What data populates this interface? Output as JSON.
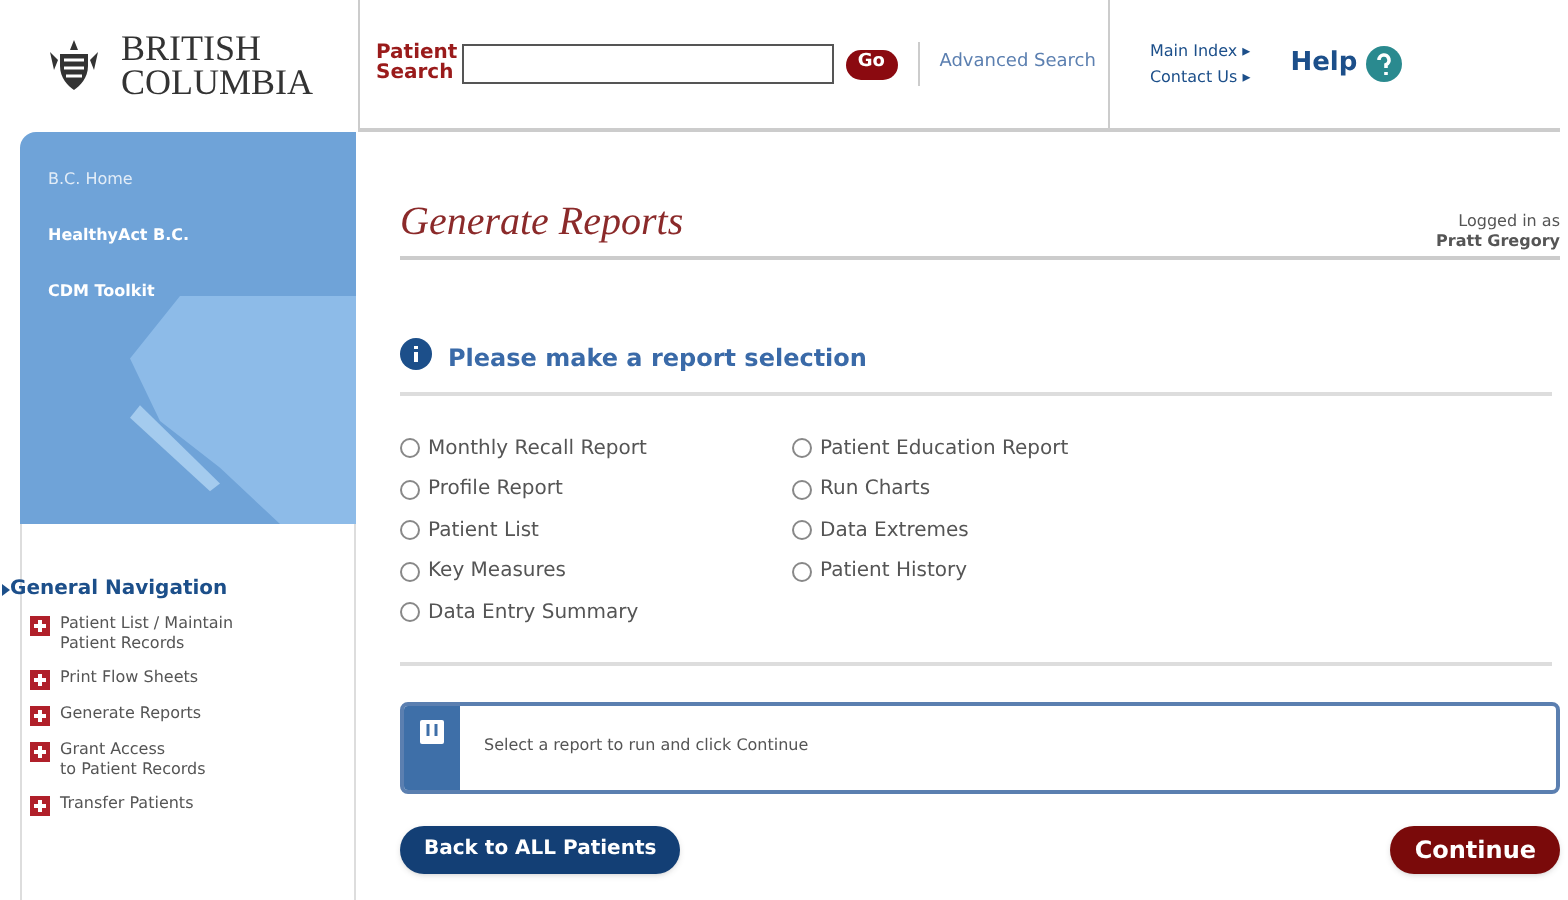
{
  "logo": {
    "lines": [
      "BRITISH",
      "COLUMBIA"
    ]
  },
  "search": {
    "label_lines": [
      "Patient",
      "Search"
    ],
    "go": "Go",
    "advanced": "Advanced Search"
  },
  "header_links": [
    "Main Index ▸",
    "Contact Us ▸"
  ],
  "help": "Help",
  "sidebar": {
    "top_links": [
      "B.C. Home",
      "HealthyAct B.C.",
      "CDM Toolkit"
    ],
    "nav_title": "General Navigation",
    "nav_items": [
      {
        "lines": [
          "Patient List / Maintain",
          "Patient Records"
        ]
      },
      {
        "lines": [
          "Print Flow Sheets"
        ]
      },
      {
        "lines": [
          "Generate Reports"
        ]
      },
      {
        "lines": [
          "Grant Access",
          "to Patient Records"
        ]
      },
      {
        "lines": [
          "Transfer Patients"
        ]
      }
    ]
  },
  "page_title": "Generate Reports",
  "login": {
    "label": "Logged in as",
    "user": "Pratt Gregory"
  },
  "prompt": "Please make a report selection",
  "report_columns": [
    [
      {
        "label": "Monthly Recall Report",
        "selected": false
      },
      {
        "label": "Profile Report",
        "selected": false
      },
      {
        "label": "Patient List",
        "selected": false
      },
      {
        "label": "Key Measures",
        "selected": false
      },
      {
        "label": "Data Entry Summary",
        "selected": false
      }
    ],
    [
      {
        "label": "Patient Education Report",
        "selected": false
      },
      {
        "label": "Run Charts",
        "selected": false
      },
      {
        "label": "Data Extremes",
        "selected": false
      },
      {
        "label": "Patient History",
        "selected": false
      }
    ]
  ],
  "message": "Select a report to run and click Continue",
  "buttons": {
    "back": "Back to ALL Patients",
    "continue": "Continue"
  }
}
